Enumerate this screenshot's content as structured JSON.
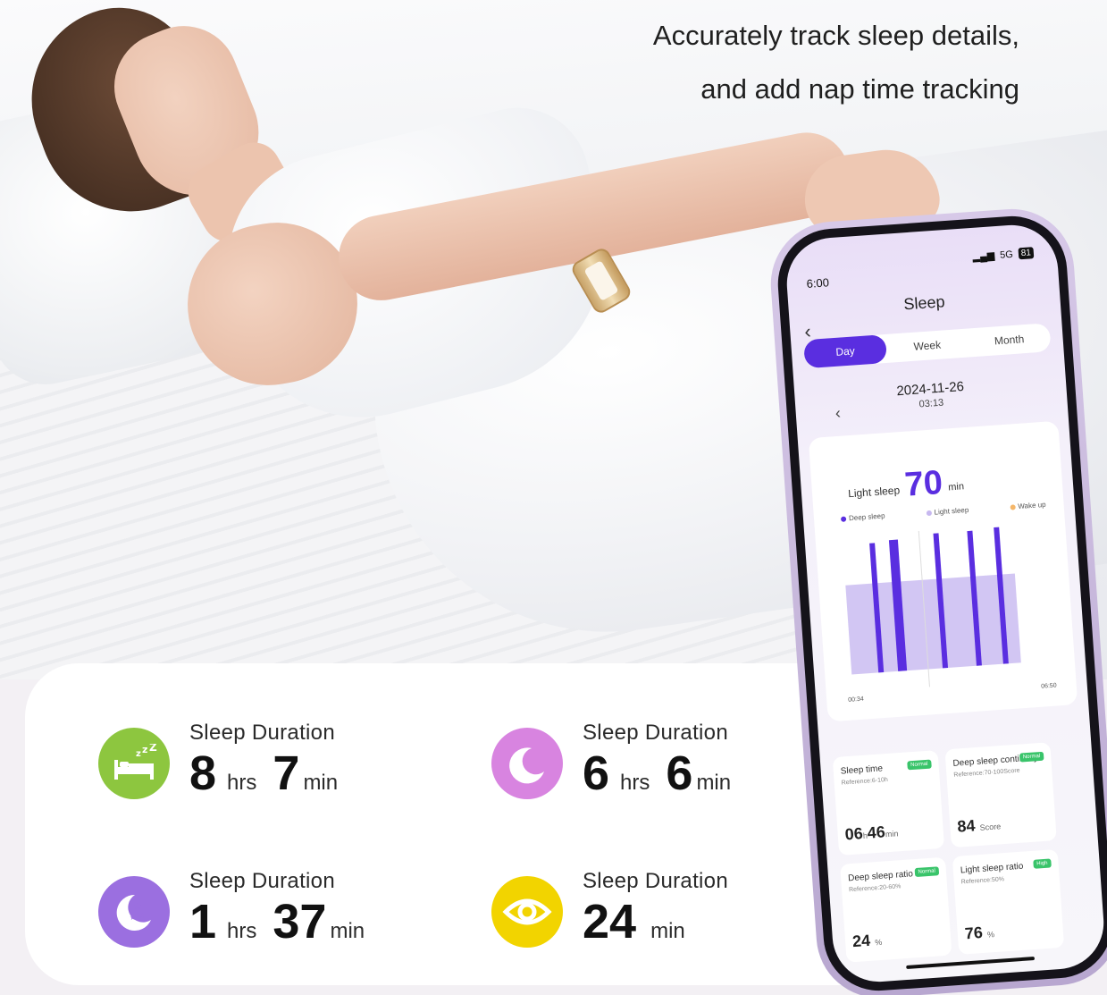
{
  "headline": {
    "line1": "Accurately track sleep details,",
    "line2": "and add nap time tracking"
  },
  "stats": [
    {
      "title": "Sleep Duration",
      "hours": "8",
      "hours_unit": "hrs",
      "minutes": "7",
      "minutes_unit": "min",
      "icon": "bed-zzz-icon",
      "color": "#8dc63f"
    },
    {
      "title": "Sleep Duration",
      "hours": "6",
      "hours_unit": "hrs",
      "minutes": "6",
      "minutes_unit": "min",
      "icon": "moon-z-icon",
      "color": "#d884e0"
    },
    {
      "title": "Sleep Duration",
      "hours": "1",
      "hours_unit": "hrs",
      "minutes": "37",
      "minutes_unit": "min",
      "icon": "moon-stars-icon",
      "color": "#9b6fe0"
    },
    {
      "title": "Sleep Duration",
      "minutes": "24",
      "minutes_unit": "min",
      "icon": "eye-icon",
      "color": "#f2d400"
    }
  ],
  "phone": {
    "status_time": "6:00",
    "signal": "5G",
    "battery": "81",
    "title": "Sleep",
    "tabs": [
      "Day",
      "Week",
      "Month"
    ],
    "active_tab": "Day",
    "date": "2024-11-26",
    "duration_time": "03:13",
    "chart_label": "Light sleep",
    "chart_value": "70",
    "chart_unit": "min",
    "legend": [
      "Deep sleep",
      "Light sleep",
      "Wake up"
    ],
    "legend_colors": [
      "#5a2ee0",
      "#c7b8f0",
      "#f5b76a"
    ],
    "x_start": "00:34",
    "x_end": "06:50",
    "metrics": [
      {
        "title": "Sleep time",
        "ref": "Reference:6-10h",
        "badge": "Normal",
        "value": "06",
        "value2": "46",
        "unit1": "h",
        "unit2": "min"
      },
      {
        "title": "Deep sleep continuity",
        "ref": "Reference:70-100Score",
        "badge": "Normal",
        "value": "84",
        "unit1": "Score"
      },
      {
        "title": "Deep sleep ratio",
        "ref": "Reference:20-60%",
        "badge": "Normal",
        "value": "24",
        "unit1": "%"
      },
      {
        "title": "Light sleep ratio",
        "ref": "Reference:50%",
        "badge": "High",
        "value": "76",
        "unit1": "%"
      }
    ]
  }
}
